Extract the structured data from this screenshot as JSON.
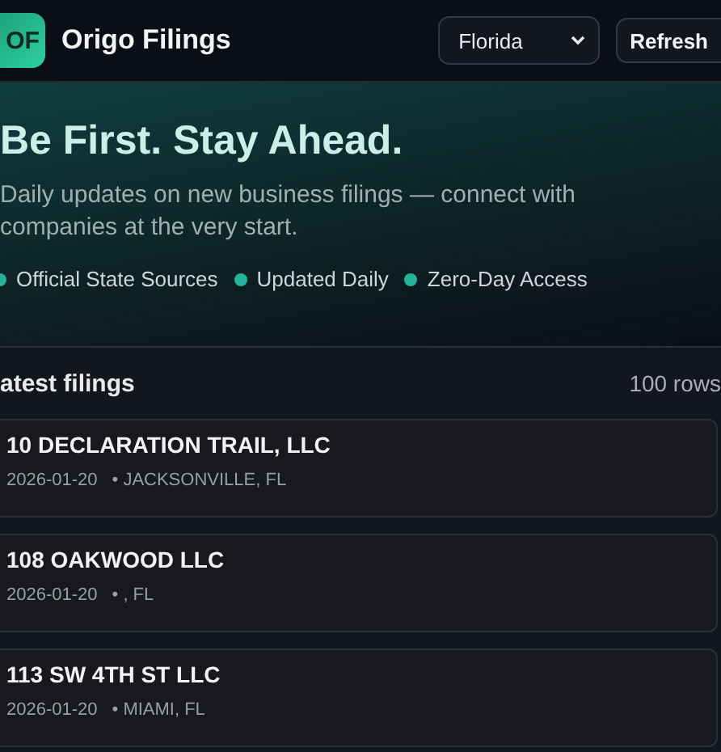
{
  "header": {
    "logo": "OF",
    "title": "Origo Filings",
    "state_select": {
      "value": "Florida"
    },
    "refresh_button": "Refresh"
  },
  "hero": {
    "headline": "Be First. Stay Ahead.",
    "description": "Daily updates on new business filings — connect with companies at the very start.",
    "features": [
      {
        "label": "Official State Sources",
        "color": "#22b39a"
      },
      {
        "label": "Updated Daily",
        "color": "#22b39a"
      },
      {
        "label": "Zero-Day Access",
        "color": "#22b39a"
      }
    ]
  },
  "filings": {
    "title": "atest filings",
    "count": "100 rows",
    "rows": [
      {
        "name": "10 DECLARATION TRAIL, LLC",
        "date": "2026-01-20",
        "location": "• JACKSONVILLE, FL"
      },
      {
        "name": "108 OAKWOOD LLC",
        "date": "2026-01-20",
        "location": "• , FL"
      },
      {
        "name": "113 SW 4TH ST LLC",
        "date": "2026-01-20",
        "location": "• MIAMI, FL"
      }
    ]
  }
}
